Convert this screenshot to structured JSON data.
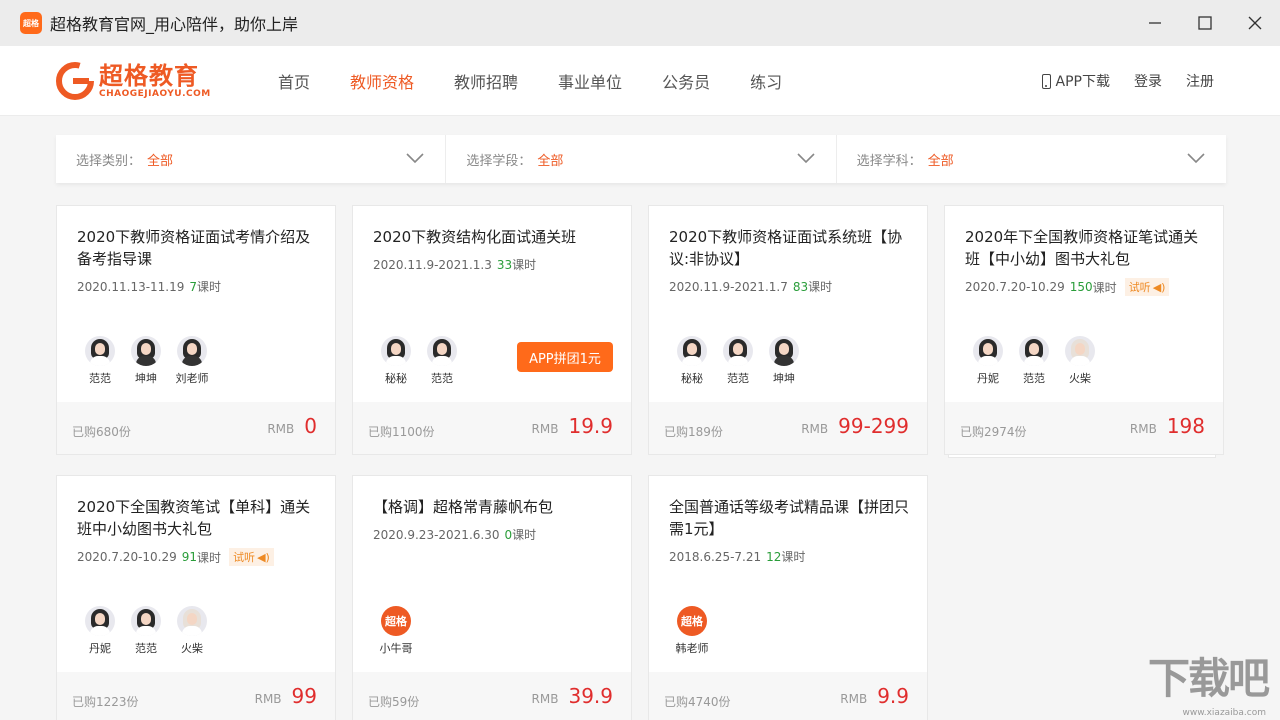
{
  "window": {
    "icon_text": "超格",
    "title": "超格教育官网_用心陪伴，助你上岸"
  },
  "logo": {
    "cn": "超格教育",
    "en": "CHAOGEJIAOYU.COM"
  },
  "nav": {
    "items": [
      "首页",
      "教师资格",
      "教师招聘",
      "事业单位",
      "公务员",
      "练习"
    ],
    "active_index": 1,
    "app_download": "APP下载",
    "login": "登录",
    "register": "注册"
  },
  "filters": [
    {
      "label": "选择类别：",
      "value": "全部"
    },
    {
      "label": "选择学段：",
      "value": "全部"
    },
    {
      "label": "选择学科：",
      "value": "全部"
    }
  ],
  "courses": [
    {
      "title": "2020下教师资格证面试考情介绍及备考指导课",
      "date": "2020.11.13-11.19",
      "lessons": "7",
      "unit": "课时",
      "teachers": [
        "范范",
        "坤坤",
        "刘老师"
      ],
      "sold": "已购680份",
      "currency": "RMB",
      "price": "0"
    },
    {
      "title": "2020下教资结构化面试通关班",
      "date": "2020.11.9-2021.1.3",
      "lessons": "33",
      "unit": "课时",
      "teachers": [
        "秘秘",
        "范范"
      ],
      "button": "APP拼团1元",
      "sold": "已购1100份",
      "currency": "RMB",
      "price": "19.9"
    },
    {
      "title": "2020下教师资格证面试系统班【协议:非协议】",
      "date": "2020.11.9-2021.1.7",
      "lessons": "83",
      "unit": "课时",
      "teachers": [
        "秘秘",
        "范范",
        "坤坤"
      ],
      "sold": "已购189份",
      "currency": "RMB",
      "price": "99-299"
    },
    {
      "title": "2020年下全国教师资格证笔试通关班【中小幼】图书大礼包",
      "date": "2020.7.20-10.29",
      "lessons": "150",
      "unit": "课时",
      "trial": "试听",
      "teachers": [
        "丹妮",
        "范范",
        "火柴"
      ],
      "sold": "已购2974份",
      "currency": "RMB",
      "price": "198"
    },
    {
      "title": "2020下全国教资笔试【单科】通关班中小幼图书大礼包",
      "date": "2020.7.20-10.29",
      "lessons": "91",
      "unit": "课时",
      "trial": "试听",
      "teachers": [
        "丹妮",
        "范范",
        "火柴"
      ],
      "sold": "已购1223份",
      "currency": "RMB",
      "price": "99"
    },
    {
      "title": "【格调】超格常青藤帆布包",
      "date": "2020.9.23-2021.6.30",
      "lessons": "0",
      "unit": "课时",
      "teachers": [
        "小牛哥"
      ],
      "logo_teacher": true,
      "sold": "已购59份",
      "currency": "RMB",
      "price": "39.9"
    },
    {
      "title": "全国普通话等级考试精品课【拼团只需1元】",
      "date": "2018.6.25-7.21",
      "lessons": "12",
      "unit": "课时",
      "teachers": [
        "韩老师"
      ],
      "logo_teacher": true,
      "sold": "已购4740份",
      "currency": "RMB",
      "price": "9.9"
    }
  ],
  "watermark": {
    "cn": "下载吧",
    "en": "www.xiazaiba.com"
  },
  "colors": {
    "accent": "#ee5a24",
    "price": "#e02d2d",
    "lessons": "#2a9d3a"
  }
}
